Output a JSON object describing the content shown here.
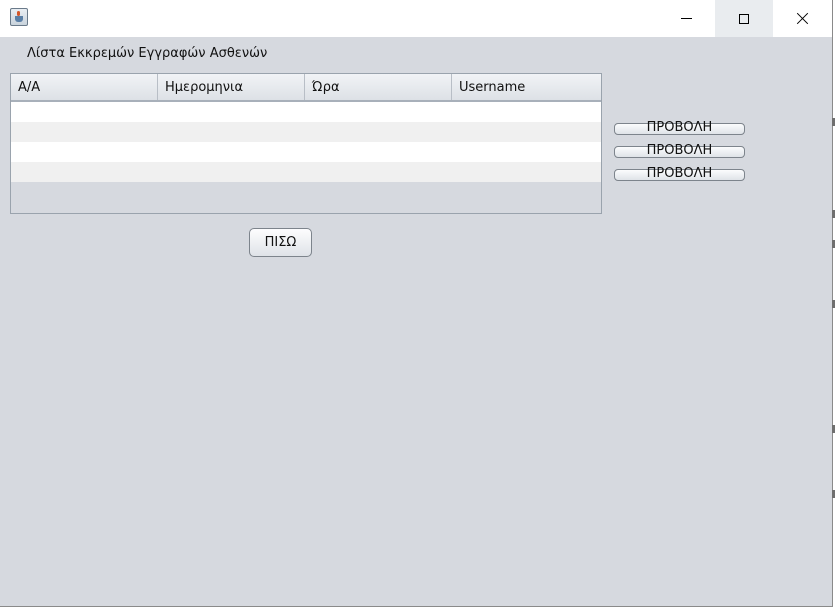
{
  "window": {
    "title": "",
    "controls": [
      "minimize",
      "maximize",
      "close"
    ]
  },
  "heading": "Λίστα Εκκρεμών Εγγραφών Ασθενών",
  "table": {
    "columns": [
      "Α/Α",
      "Ημερομηνια",
      "Ώρα",
      "Username"
    ],
    "rows": [
      [
        "",
        "",
        "",
        ""
      ],
      [
        "",
        "",
        "",
        ""
      ],
      [
        "",
        "",
        "",
        ""
      ],
      [
        "",
        "",
        "",
        ""
      ]
    ]
  },
  "view_buttons": [
    "ΠΡΟΒΟΛΗ",
    "ΠΡΟΒΟΛΗ",
    "ΠΡΟΒΟΛΗ"
  ],
  "back_button": "ΠΙΣΩ",
  "icons": {
    "app": "java-cup-icon",
    "minimize": "minimize-icon",
    "maximize": "maximize-icon",
    "close": "close-icon"
  }
}
